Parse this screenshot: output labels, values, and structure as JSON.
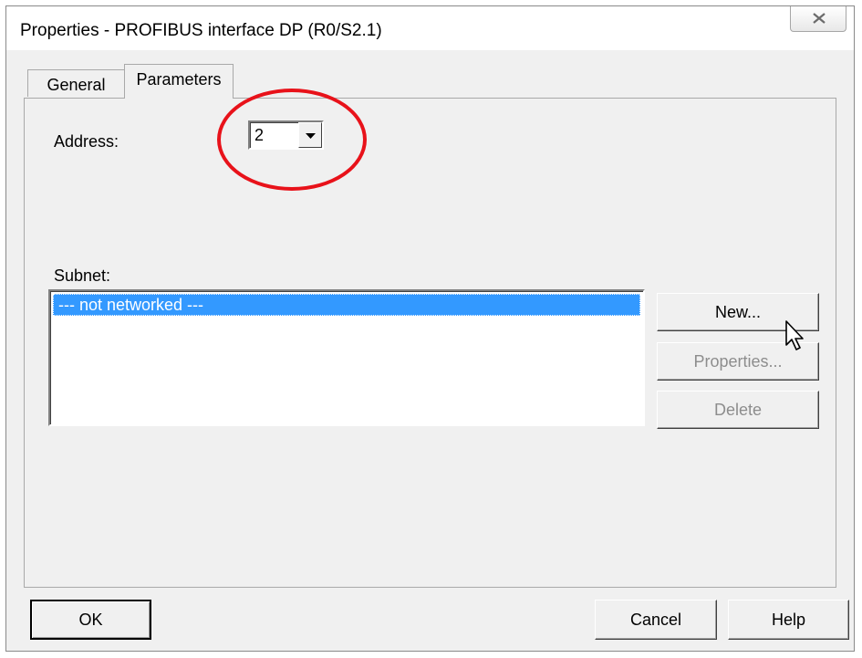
{
  "window": {
    "title": "Properties - PROFIBUS interface  DP (R0/S2.1)"
  },
  "tabs": [
    {
      "label": "General",
      "active": false
    },
    {
      "label": "Parameters",
      "active": true
    }
  ],
  "parameters": {
    "address_label": "Address:",
    "address_value": "2",
    "subnet_label": "Subnet:",
    "subnet_items": [
      "--- not networked ---"
    ],
    "selected_subnet_index": 0
  },
  "subnet_buttons": {
    "new_label": "New...",
    "properties_label": "Properties...",
    "delete_label": "Delete"
  },
  "footer": {
    "ok_label": "OK",
    "cancel_label": "Cancel",
    "help_label": "Help"
  },
  "annotation": {
    "highlight_color": "#e8121a"
  },
  "colors": {
    "selection": "#3399ff",
    "dialog_bg": "#f0f0f0"
  },
  "icons": [
    "close-icon",
    "dropdown-arrow-icon",
    "mouse-pointer-icon"
  ]
}
